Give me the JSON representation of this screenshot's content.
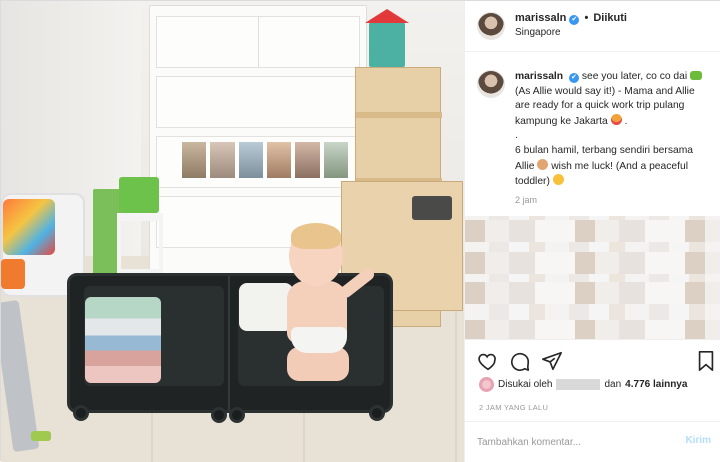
{
  "header": {
    "username": "marissaln",
    "verified_glyph": "✔",
    "separator": "•",
    "follow_status": "Diikuti",
    "location": "Singapore"
  },
  "caption": {
    "username": "marissaln",
    "line1_pre": "see you later, co co dai",
    "line1_post": "(As Allie would say it!) - Mama and Allie are ready for a quick work trip pulang kampung ke Jakarta",
    "line1_end": ".",
    "line2": ".",
    "line3_pre": "6 bulan hamil, terbang sendiri bersama Allie",
    "line3_post": "wish me luck! (And a peaceful toddler)",
    "emojis": [
      "crocodile-emoji",
      "heart-eyes-emoji",
      "flexed-arm-emoji",
      "smile-emoji"
    ],
    "time": "2 jam"
  },
  "actions": {
    "like_icon": "heart-icon",
    "comment_icon": "comment-icon",
    "share_icon": "share-icon",
    "save_icon": "bookmark-icon"
  },
  "likes": {
    "prefix": "Disukai oleh",
    "middle": "dan",
    "count": "4.776 lainnya"
  },
  "posted_ago": "2 JAM YANG LALU",
  "comment_box": {
    "placeholder": "Tambahkan komentar...",
    "send_label": "Kirim"
  },
  "colors": {
    "verified": "#3897f0",
    "send_disabled": "#b2dffc",
    "border": "#efefef"
  }
}
